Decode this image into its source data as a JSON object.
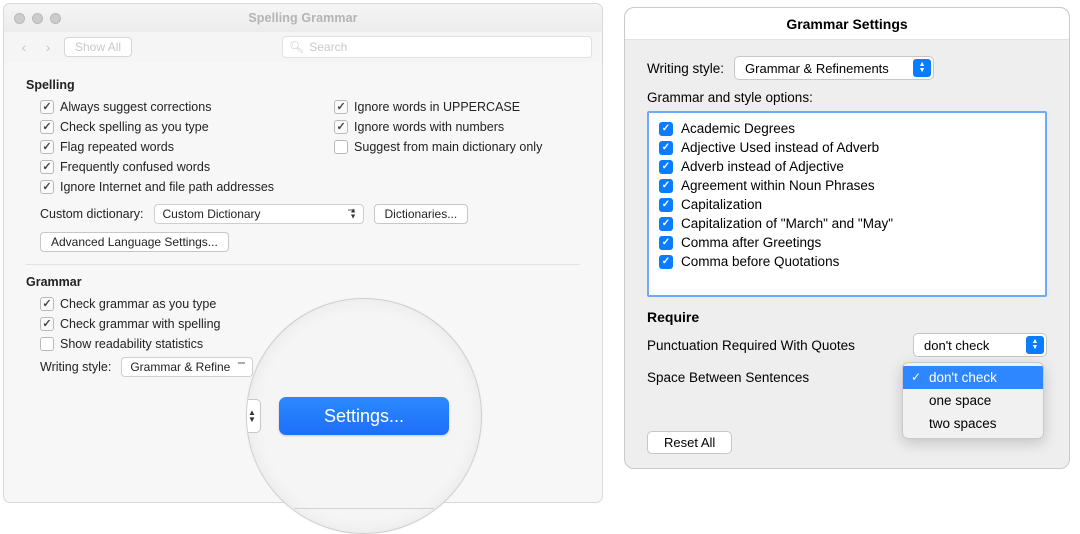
{
  "leftWindow": {
    "title": "Spelling  Grammar",
    "showAll": "Show All",
    "searchPlaceholder": "Search",
    "spellingHeading": "Spelling",
    "spellingLeft": [
      {
        "label": "Always suggest corrections",
        "checked": true
      },
      {
        "label": "Check spelling as you type",
        "checked": true
      },
      {
        "label": "Flag repeated words",
        "checked": true
      },
      {
        "label": "Frequently confused words",
        "checked": true
      },
      {
        "label": "Ignore Internet and file path addresses",
        "checked": true
      }
    ],
    "spellingRight": [
      {
        "label": "Ignore words in UPPERCASE",
        "checked": true
      },
      {
        "label": "Ignore words with numbers",
        "checked": true
      },
      {
        "label": "Suggest from main dictionary only",
        "checked": false
      }
    ],
    "customDictLabel": "Custom dictionary:",
    "customDictValue": "Custom Dictionary",
    "dictionariesBtn": "Dictionaries...",
    "advancedBtn": "Advanced Language Settings...",
    "grammarHeading": "Grammar",
    "grammarOptions": [
      {
        "label": "Check grammar as you type",
        "checked": true
      },
      {
        "label": "Check grammar with spelling",
        "checked": true
      },
      {
        "label": "Show readability statistics",
        "checked": false
      }
    ],
    "writingStyleLabel": "Writing style:",
    "writingStyleValue": "Grammar & Refine",
    "settingsBtn": "Settings..."
  },
  "rightDialog": {
    "title": "Grammar Settings",
    "writingStyleLabel": "Writing style:",
    "writingStyleValue": "Grammar & Refinements",
    "optionsHeading": "Grammar and style options:",
    "options": [
      "Academic Degrees",
      "Adjective Used instead of Adverb",
      "Adverb instead of Adjective",
      "Agreement within Noun Phrases",
      "Capitalization",
      "Capitalization of \"March\" and \"May\"",
      "Comma after Greetings",
      "Comma before Quotations"
    ],
    "requireHeading": "Require",
    "punctLabel": "Punctuation Required With Quotes",
    "punctValue": "don't check",
    "spaceLabel": "Space Between Sentences",
    "resetAll": "Reset All",
    "dropdown": {
      "items": [
        "don't check",
        "one space",
        "two spaces"
      ],
      "selectedIndex": 0
    }
  }
}
